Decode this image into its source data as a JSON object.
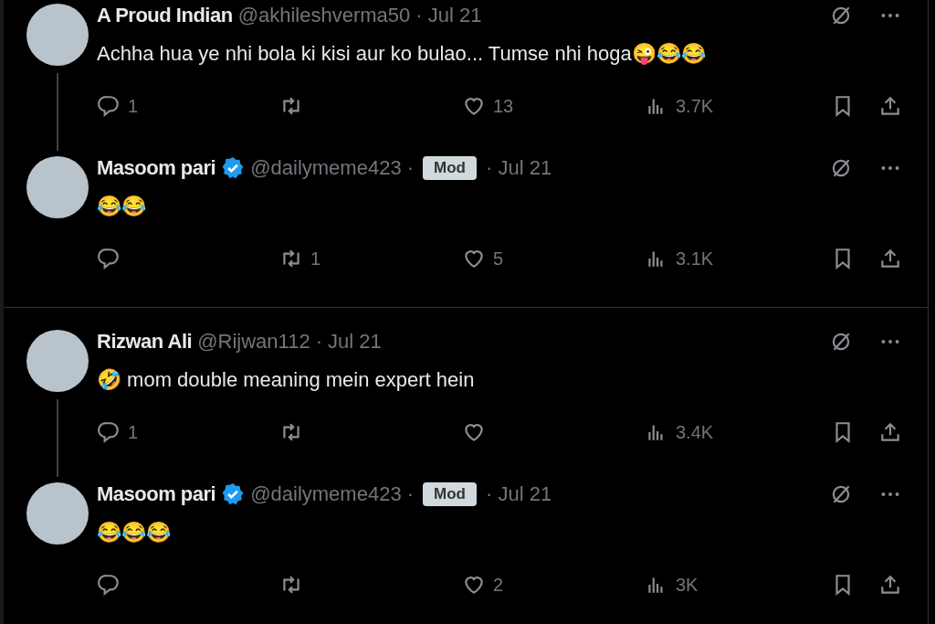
{
  "threads": [
    {
      "tweets": [
        {
          "name": "A Proud Indian",
          "verified": false,
          "handle": "@akhileshverma50",
          "date": "· Jul 21",
          "text": "Achha hua ye nhi bola ki kisi aur ko bulao... Tumse nhi hoga😜😂😂",
          "replies": "1",
          "views": "3.7K",
          "likes": "13"
        },
        {
          "name": "Masoom pari",
          "verified": true,
          "handle": "@dailymeme423 ·",
          "badge": "Mod",
          "date": "· Jul 21",
          "text": "😂😂",
          "reposts": "1",
          "likes": "5",
          "views": "3.1K"
        }
      ]
    },
    {
      "tweets": [
        {
          "name": "Rizwan Ali",
          "verified": false,
          "handle": "@Rijwan112",
          "date": "· Jul 21",
          "text": "🤣 mom double meaning mein expert hein",
          "replies": "1",
          "views": "3.4K"
        },
        {
          "name": "Masoom pari",
          "verified": true,
          "handle": "@dailymeme423 ·",
          "badge": "Mod",
          "date": "· Jul 21",
          "text": "😂😂😂",
          "likes": "2",
          "views": "3K"
        }
      ]
    }
  ]
}
